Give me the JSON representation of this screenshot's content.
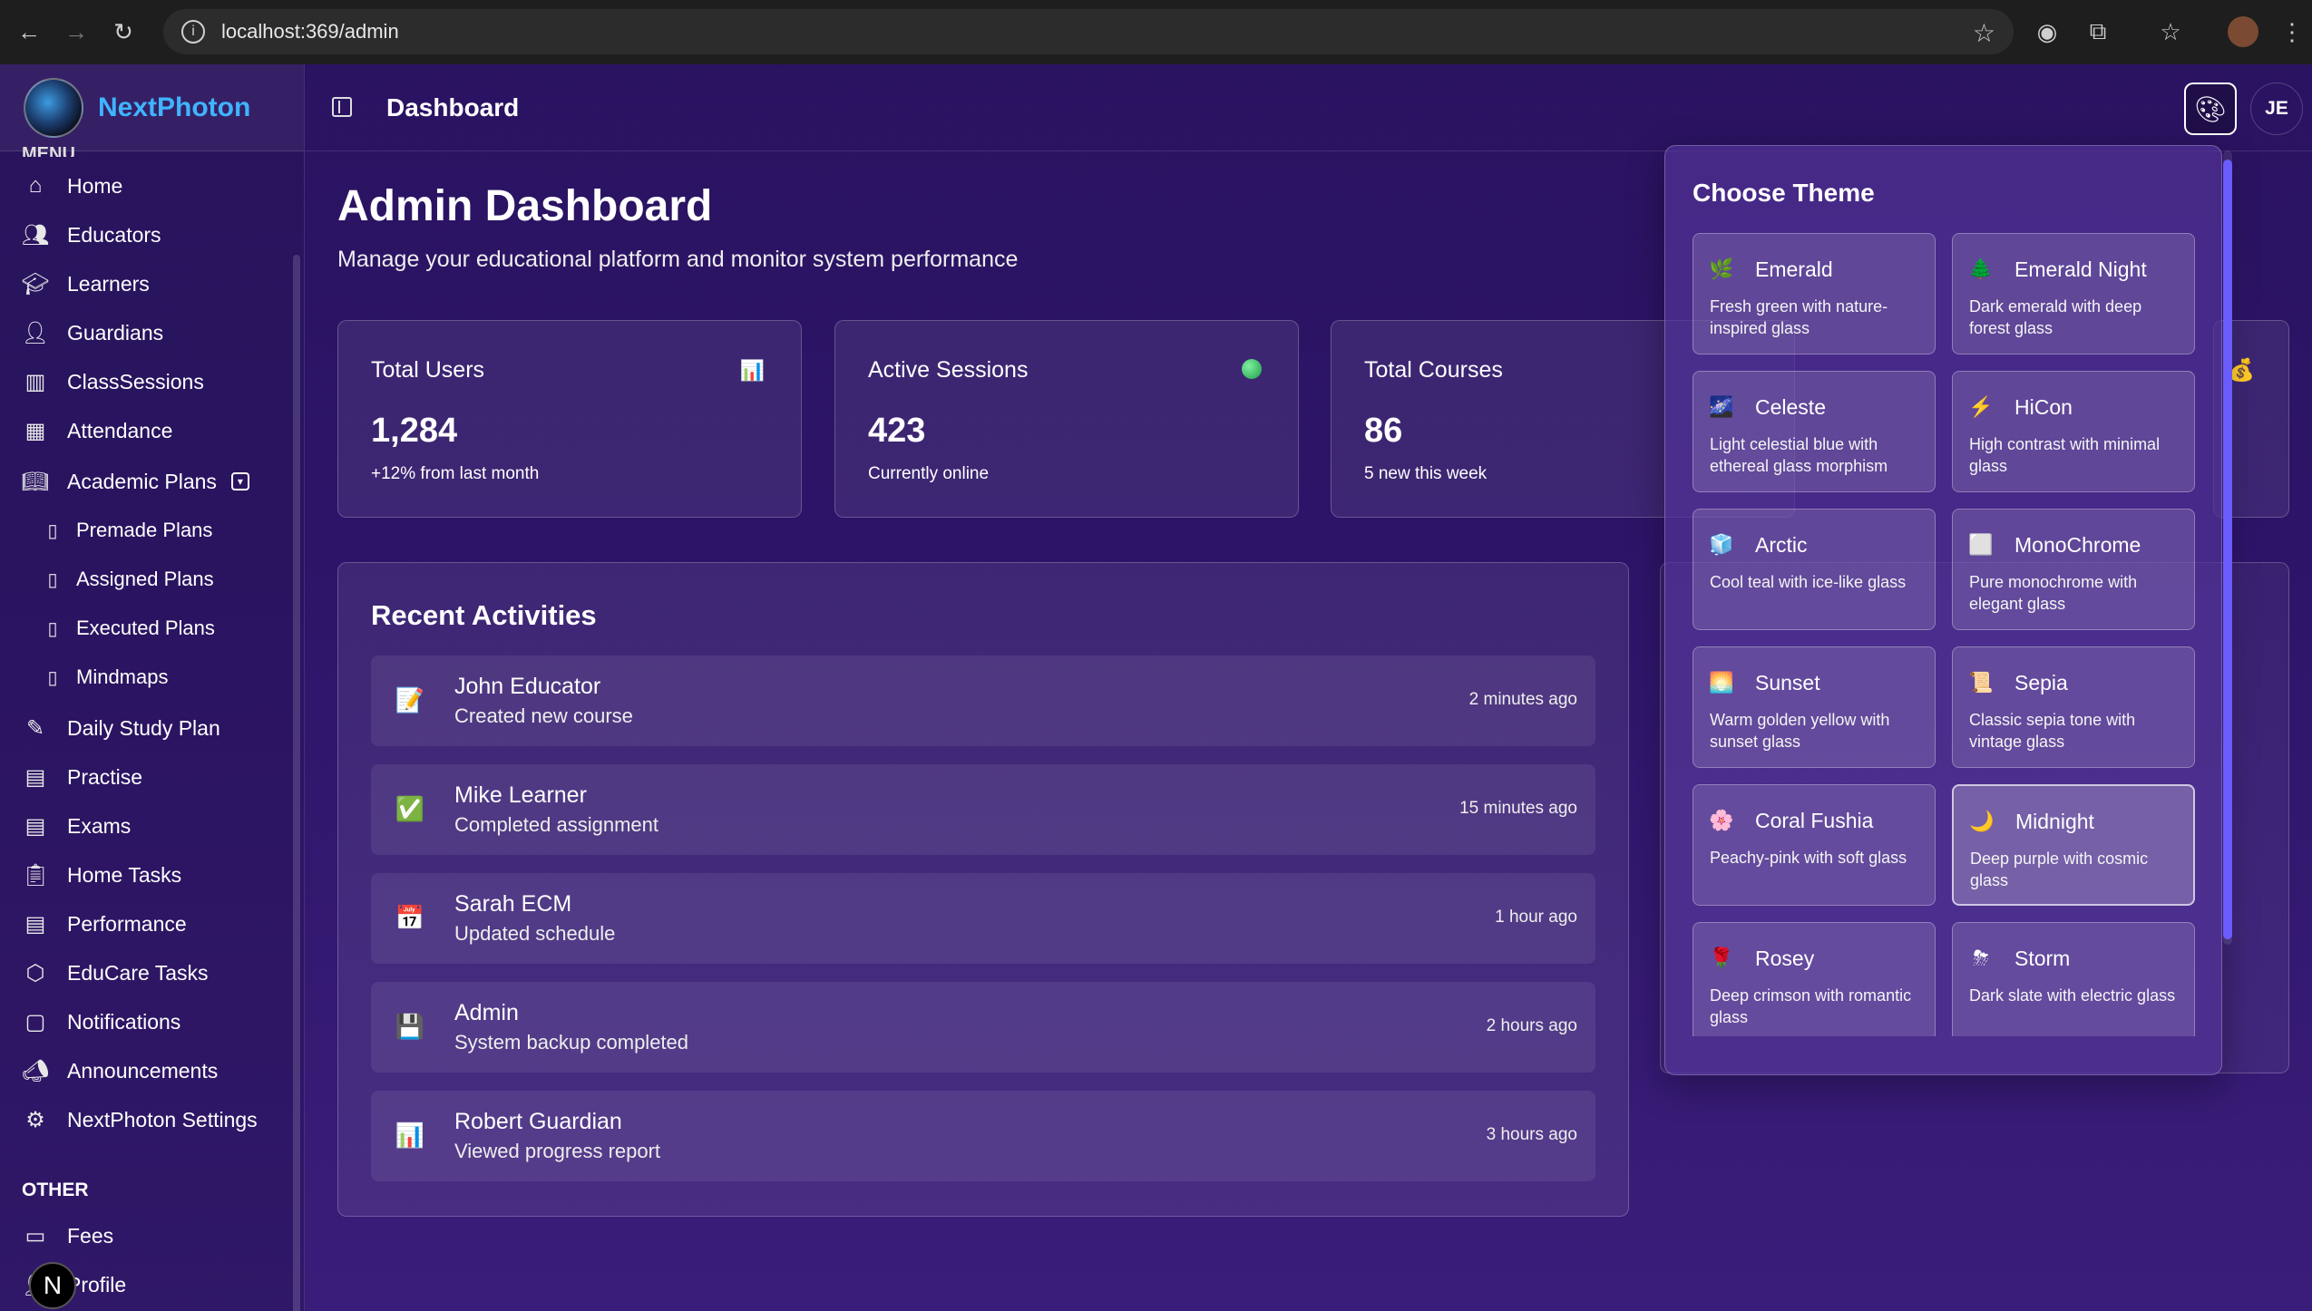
{
  "browser": {
    "url": "localhost:369/admin"
  },
  "brand": {
    "name": "NextPhoton"
  },
  "menu": {
    "cut_label": "MENU",
    "items": [
      {
        "label": "Home",
        "icon": "home-icon"
      },
      {
        "label": "Educators",
        "icon": "users-icon"
      },
      {
        "label": "Learners",
        "icon": "graduation-cap-icon"
      },
      {
        "label": "Guardians",
        "icon": "user-icon"
      },
      {
        "label": "ClassSessions",
        "icon": "building-icon"
      },
      {
        "label": "Attendance",
        "icon": "calendar-icon"
      },
      {
        "label": "Academic Plans",
        "icon": "book-open-icon"
      },
      {
        "label": "Premade Plans",
        "icon": "book-icon"
      },
      {
        "label": "Assigned Plans",
        "icon": "book-icon"
      },
      {
        "label": "Executed Plans",
        "icon": "book-icon"
      },
      {
        "label": "Mindmaps",
        "icon": "book-icon"
      },
      {
        "label": "Daily Study Plan",
        "icon": "notebook-pen-icon"
      },
      {
        "label": "Practise",
        "icon": "file-text-icon"
      },
      {
        "label": "Exams",
        "icon": "file-text-icon"
      },
      {
        "label": "Home Tasks",
        "icon": "clipboard-icon"
      },
      {
        "label": "Performance",
        "icon": "file-text-icon"
      },
      {
        "label": "EduCare Tasks",
        "icon": "boxes-icon"
      },
      {
        "label": "Notifications",
        "icon": "message-square-icon"
      },
      {
        "label": "Announcements",
        "icon": "megaphone-icon"
      },
      {
        "label": "NextPhoton Settings",
        "icon": "gear-icon"
      }
    ],
    "other_label": "OTHER",
    "other_items": [
      {
        "label": "Fees",
        "icon": "wallet-icon"
      },
      {
        "label": "Profile",
        "icon": "user-icon"
      }
    ],
    "badge": "N"
  },
  "header": {
    "title": "Dashboard",
    "avatar_initials": "JE"
  },
  "main": {
    "title": "Admin Dashboard",
    "subtitle": "Manage your educational platform and monitor system performance",
    "stats": [
      {
        "title": "Total Users",
        "value": "1,284",
        "note": "+12% from last month",
        "icon": "📊"
      },
      {
        "title": "Active Sessions",
        "value": "423",
        "note": "Currently online",
        "icon": "green-dot-icon"
      },
      {
        "title": "Total Courses",
        "value": "86",
        "note": "5 new this week",
        "icon": ""
      }
    ],
    "activities_title": "Recent Activities",
    "activities": [
      {
        "name": "John Educator",
        "desc": "Created new course",
        "time": "2 minutes ago",
        "icon": "📝"
      },
      {
        "name": "Mike Learner",
        "desc": "Completed assignment",
        "time": "15 minutes ago",
        "icon": "✅"
      },
      {
        "name": "Sarah ECM",
        "desc": "Updated schedule",
        "time": "1 hour ago",
        "icon": "📅"
      },
      {
        "name": "Admin",
        "desc": "System backup completed",
        "time": "2 hours ago",
        "icon": "💾"
      },
      {
        "name": "Robert Guardian",
        "desc": "Viewed progress report",
        "time": "3 hours ago",
        "icon": "📊"
      }
    ],
    "money_icon": "💰"
  },
  "theme_panel": {
    "heading": "Choose Theme",
    "themes": [
      {
        "name": "Emerald",
        "desc": "Fresh green with nature-inspired glass",
        "emoji": "🌿"
      },
      {
        "name": "Emerald Night",
        "desc": "Dark emerald with deep forest glass",
        "emoji": "🌲"
      },
      {
        "name": "Celeste",
        "desc": "Light celestial blue with ethereal glass morphism",
        "emoji": "🌌"
      },
      {
        "name": "HiCon",
        "desc": "High contrast with minimal glass",
        "emoji": "⚡"
      },
      {
        "name": "Arctic",
        "desc": "Cool teal with ice-like glass",
        "emoji": "🧊"
      },
      {
        "name": "MonoChrome",
        "desc": "Pure monochrome with elegant glass",
        "emoji": "⬜"
      },
      {
        "name": "Sunset",
        "desc": "Warm golden yellow with sunset glass",
        "emoji": "🌅"
      },
      {
        "name": "Sepia",
        "desc": "Classic sepia tone with vintage glass",
        "emoji": "📜"
      },
      {
        "name": "Coral Fushia",
        "desc": "Peachy-pink with soft glass",
        "emoji": "🌸"
      },
      {
        "name": "Midnight",
        "desc": "Deep purple with cosmic glass",
        "emoji": "🌙",
        "selected": true
      },
      {
        "name": "Rosey",
        "desc": "Deep crimson with romantic glass",
        "emoji": "🌹"
      },
      {
        "name": "Storm",
        "desc": "Dark slate with electric glass",
        "emoji": "⛈"
      }
    ]
  }
}
